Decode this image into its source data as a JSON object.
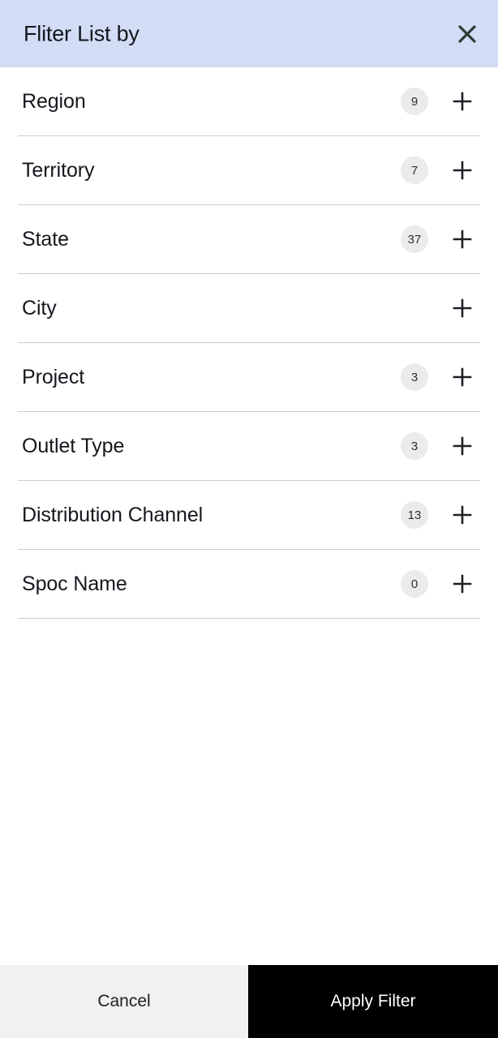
{
  "header": {
    "title": "Fliter List by",
    "background_color": "#d2dcf5",
    "close_icon": "close-icon"
  },
  "list": {
    "rows": [
      {
        "label": "Region",
        "count": "9",
        "has_count": true,
        "add_icon": "plus-icon"
      },
      {
        "label": "Territory",
        "count": "7",
        "has_count": true,
        "add_icon": "plus-icon"
      },
      {
        "label": "State",
        "count": "37",
        "has_count": true,
        "add_icon": "plus-icon"
      },
      {
        "label": "City",
        "count": "",
        "has_count": false,
        "add_icon": "plus-icon"
      },
      {
        "label": "Project",
        "count": "3",
        "has_count": true,
        "add_icon": "plus-icon"
      },
      {
        "label": "Outlet Type",
        "count": "3",
        "has_count": true,
        "add_icon": "plus-icon"
      },
      {
        "label": "Distribution Channel",
        "count": "13",
        "has_count": true,
        "add_icon": "plus-icon"
      },
      {
        "label": "Spoc Name",
        "count": "0",
        "has_count": true,
        "add_icon": "plus-icon"
      }
    ]
  },
  "footer": {
    "cancel_label": "Cancel",
    "apply_label": "Apply Filter",
    "cancel_background": "#f1f1f1",
    "apply_background": "#000000"
  }
}
